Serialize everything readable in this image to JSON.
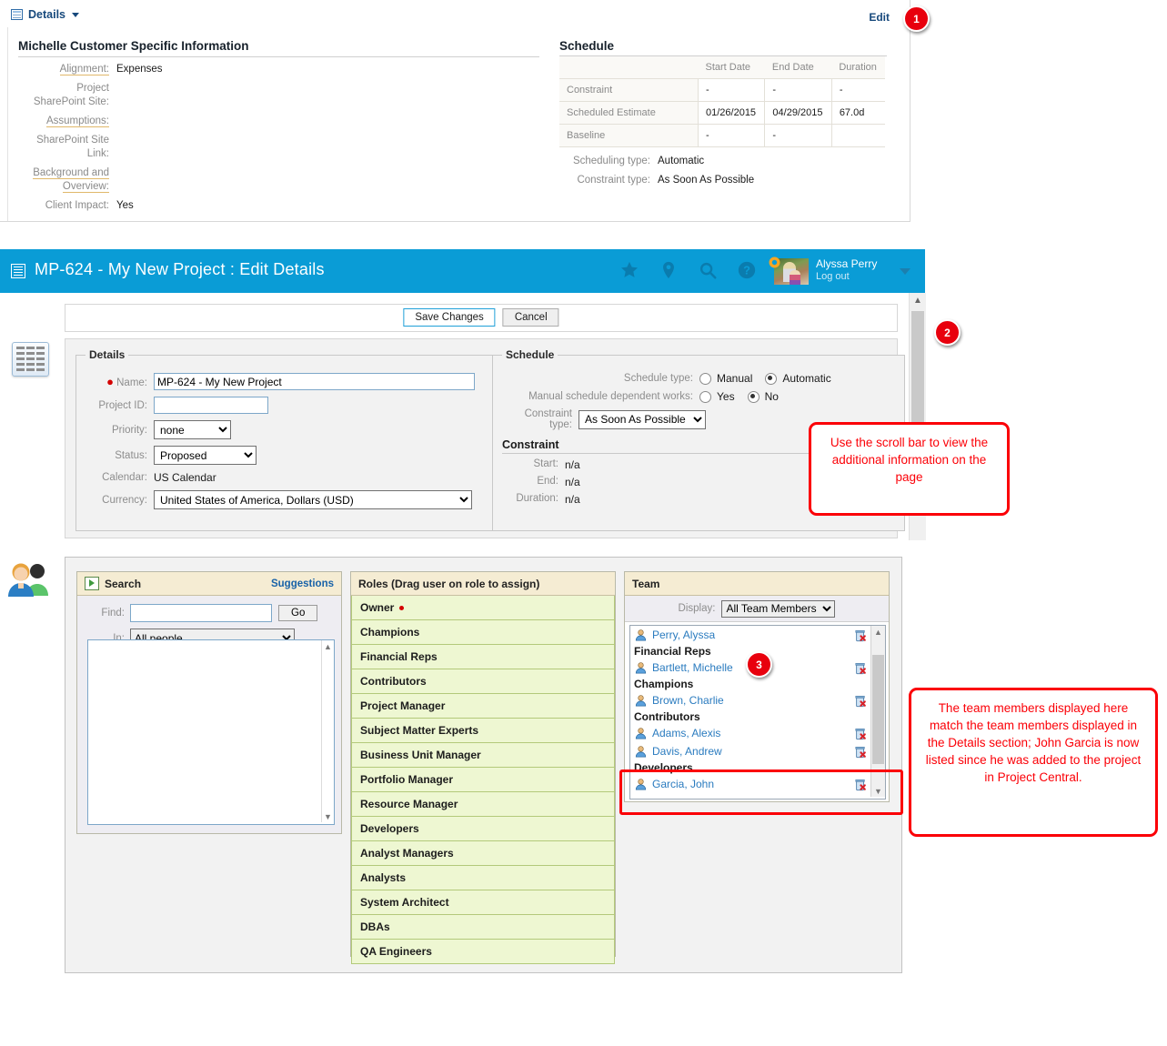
{
  "panel1": {
    "header_label": "Details",
    "edit_link": "Edit",
    "custom_section_title": "Michelle Customer Specific Information",
    "custom_fields": [
      {
        "label": "Alignment:",
        "value": "Expenses",
        "underline": true
      },
      {
        "label": "Project SharePoint Site:",
        "value": "",
        "underline": false
      },
      {
        "label": "Assumptions:",
        "value": "",
        "underline": true
      },
      {
        "label": "SharePoint Site Link:",
        "value": "",
        "underline": false
      },
      {
        "label": "Background and Overview:",
        "value": "",
        "underline": true
      },
      {
        "label": "Client Impact:",
        "value": "Yes",
        "underline": false
      }
    ],
    "schedule_section_title": "Schedule",
    "schedule_columns": [
      "",
      "Start Date",
      "End Date",
      "Duration"
    ],
    "schedule_rows": [
      {
        "name": "Constraint",
        "start": "-",
        "end": "-",
        "duration": "-"
      },
      {
        "name": "Scheduled Estimate",
        "start": "01/26/2015",
        "end": "04/29/2015",
        "duration": "67.0d"
      },
      {
        "name": "Baseline",
        "start": "-",
        "end": "-",
        "duration": ""
      }
    ],
    "scheduling_type_label": "Scheduling type:",
    "scheduling_type_value": "Automatic",
    "constraint_type_label": "Constraint type:",
    "constraint_type_value": "As Soon As Possible"
  },
  "panel2": {
    "topbar": {
      "title": "MP-624 - My New Project : Edit Details",
      "user_name": "Alyssa Perry",
      "logout": "Log out"
    },
    "buttons": {
      "save": "Save Changes",
      "cancel": "Cancel"
    },
    "details": {
      "legend": "Details",
      "name_label": "Name:",
      "name_value": "MP-624 - My New Project",
      "project_id_label": "Project ID:",
      "project_id_value": "",
      "priority_label": "Priority:",
      "priority_value": "none",
      "status_label": "Status:",
      "status_value": "Proposed",
      "calendar_label": "Calendar:",
      "calendar_value": "US Calendar",
      "currency_label": "Currency:",
      "currency_value": "United States of America, Dollars (USD)"
    },
    "schedule": {
      "legend": "Schedule",
      "schedule_type_label": "Schedule type:",
      "schedule_type_manual": "Manual",
      "schedule_type_automatic": "Automatic",
      "schedule_type_selected": "Automatic",
      "dependent_label": "Manual schedule dependent works:",
      "dependent_yes": "Yes",
      "dependent_no": "No",
      "dependent_selected": "No",
      "constraint_type_label": "Constraint type:",
      "constraint_type_value": "As Soon As Possible",
      "constraint_heading": "Constraint",
      "start_label": "Start:",
      "start_value": "n/a",
      "end_label": "End:",
      "end_value": "n/a",
      "duration_label": "Duration:",
      "duration_value": "n/a"
    }
  },
  "panel3": {
    "search": {
      "title": "Search",
      "suggestions": "Suggestions",
      "find_label": "Find:",
      "find_value": "",
      "go_label": "Go",
      "in_label": "In:",
      "in_value": "All people"
    },
    "roles": {
      "title": "Roles (Drag user on role to assign)",
      "items": [
        {
          "label": "Owner",
          "required": true
        },
        {
          "label": "Champions",
          "required": false
        },
        {
          "label": "Financial Reps",
          "required": false
        },
        {
          "label": "Contributors",
          "required": false
        },
        {
          "label": "Project Manager",
          "required": false
        },
        {
          "label": "Subject Matter Experts",
          "required": false
        },
        {
          "label": "Business Unit Manager",
          "required": false
        },
        {
          "label": "Portfolio Manager",
          "required": false
        },
        {
          "label": "Resource Manager",
          "required": false
        },
        {
          "label": "Developers",
          "required": false
        },
        {
          "label": "Analyst Managers",
          "required": false
        },
        {
          "label": "Analysts",
          "required": false
        },
        {
          "label": "System Architect",
          "required": false
        },
        {
          "label": "DBAs",
          "required": false
        },
        {
          "label": "QA Engineers",
          "required": false
        }
      ]
    },
    "team": {
      "title": "Team",
      "display_label": "Display:",
      "display_value": "All Team Members",
      "rows": [
        {
          "type": "member",
          "name": "Perry, Alyssa"
        },
        {
          "type": "group",
          "name": "Financial Reps"
        },
        {
          "type": "member",
          "name": "Bartlett, Michelle"
        },
        {
          "type": "group",
          "name": "Champions"
        },
        {
          "type": "member",
          "name": "Brown, Charlie"
        },
        {
          "type": "group",
          "name": "Contributors"
        },
        {
          "type": "member",
          "name": "Adams, Alexis"
        },
        {
          "type": "member",
          "name": "Davis, Andrew"
        },
        {
          "type": "group",
          "name": "Developers"
        },
        {
          "type": "member",
          "name": "Garcia, John"
        }
      ]
    }
  },
  "annotations": {
    "badge1": "1",
    "badge2": "2",
    "badge3": "3",
    "callout2": "Use the scroll bar to view the additional information on the page",
    "callout3": "The team members displayed here match the team members displayed in the Details section; John Garcia is now listed since he was added to the project in Project Central.",
    "accent_red": "#fb0007",
    "accent_blue": "#0a9cd6"
  }
}
